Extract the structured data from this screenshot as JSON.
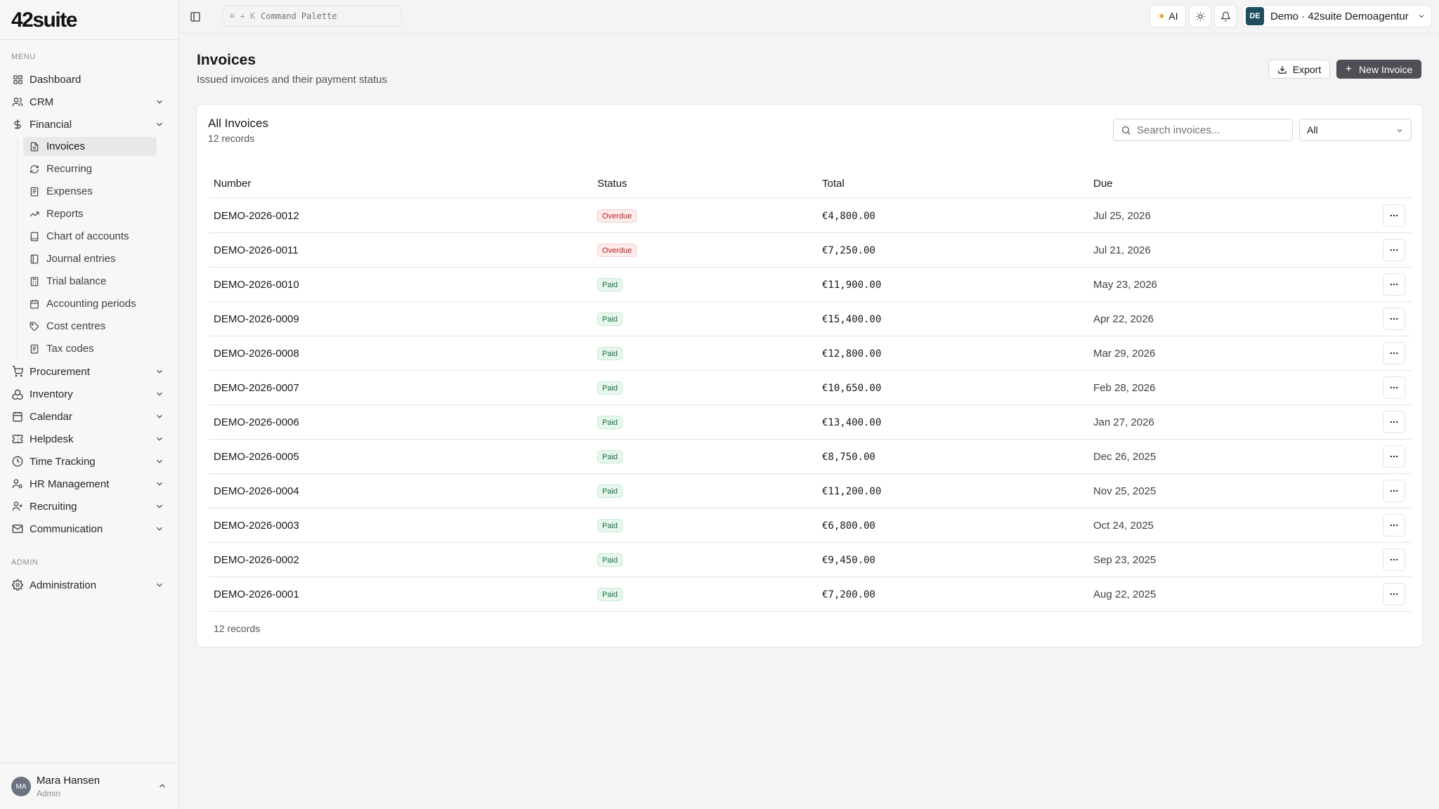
{
  "app": {
    "logo": "42suite"
  },
  "sidebar": {
    "menu_label": "MENU",
    "admin_label": "ADMIN",
    "items": [
      {
        "label": "Dashboard",
        "icon": "grid-icon"
      },
      {
        "label": "CRM",
        "icon": "users-icon"
      },
      {
        "label": "Financial",
        "icon": "dollar-icon"
      }
    ],
    "financial_sub": [
      {
        "label": "Invoices",
        "icon": "file-icon"
      },
      {
        "label": "Recurring",
        "icon": "refresh-icon"
      },
      {
        "label": "Expenses",
        "icon": "receipt-icon"
      },
      {
        "label": "Reports",
        "icon": "trending-icon"
      },
      {
        "label": "Chart of accounts",
        "icon": "book-icon"
      },
      {
        "label": "Journal entries",
        "icon": "book-open-icon"
      },
      {
        "label": "Trial balance",
        "icon": "calculator-icon"
      },
      {
        "label": "Accounting periods",
        "icon": "calendar-icon"
      },
      {
        "label": "Cost centres",
        "icon": "tag-icon"
      },
      {
        "label": "Tax codes",
        "icon": "receipt-icon"
      }
    ],
    "more_items": [
      {
        "label": "Procurement",
        "icon": "cart-icon"
      },
      {
        "label": "Inventory",
        "icon": "boxes-icon"
      },
      {
        "label": "Calendar",
        "icon": "calendar-icon"
      },
      {
        "label": "Helpdesk",
        "icon": "ticket-icon"
      },
      {
        "label": "Time Tracking",
        "icon": "clock-icon"
      },
      {
        "label": "HR Management",
        "icon": "user-cog-icon"
      },
      {
        "label": "Recruiting",
        "icon": "user-plus-icon"
      },
      {
        "label": "Communication",
        "icon": "mail-icon"
      }
    ],
    "admin_items": [
      {
        "label": "Administration",
        "icon": "gear-icon"
      }
    ],
    "user": {
      "initials": "MA",
      "name": "Mara Hansen",
      "role": "Admin"
    }
  },
  "topbar": {
    "command_kbd": "⌘ + K",
    "command_label": "Command Palette",
    "ai_label": "AI",
    "org_initials": "DE",
    "org_label": "Demo · 42suite Demoagentur"
  },
  "page": {
    "title": "Invoices",
    "subtitle": "Issued invoices and their payment status",
    "export_label": "Export",
    "new_label": "New Invoice"
  },
  "card": {
    "title": "All Invoices",
    "count": "12 records",
    "search_placeholder": "Search invoices...",
    "filter_value": "All",
    "footer_count": "12 records",
    "columns": [
      "Number",
      "Status",
      "Total",
      "Due"
    ]
  },
  "invoices": [
    {
      "number": "DEMO-2026-0012",
      "status": "Overdue",
      "total": "€4,800.00",
      "due": "Jul 25, 2026"
    },
    {
      "number": "DEMO-2026-0011",
      "status": "Overdue",
      "total": "€7,250.00",
      "due": "Jul 21, 2026"
    },
    {
      "number": "DEMO-2026-0010",
      "status": "Paid",
      "total": "€11,900.00",
      "due": "May 23, 2026"
    },
    {
      "number": "DEMO-2026-0009",
      "status": "Paid",
      "total": "€15,400.00",
      "due": "Apr 22, 2026"
    },
    {
      "number": "DEMO-2026-0008",
      "status": "Paid",
      "total": "€12,800.00",
      "due": "Mar 29, 2026"
    },
    {
      "number": "DEMO-2026-0007",
      "status": "Paid",
      "total": "€10,650.00",
      "due": "Feb 28, 2026"
    },
    {
      "number": "DEMO-2026-0006",
      "status": "Paid",
      "total": "€13,400.00",
      "due": "Jan 27, 2026"
    },
    {
      "number": "DEMO-2026-0005",
      "status": "Paid",
      "total": "€8,750.00",
      "due": "Dec 26, 2025"
    },
    {
      "number": "DEMO-2026-0004",
      "status": "Paid",
      "total": "€11,200.00",
      "due": "Nov 25, 2025"
    },
    {
      "number": "DEMO-2026-0003",
      "status": "Paid",
      "total": "€6,800.00",
      "due": "Oct 24, 2025"
    },
    {
      "number": "DEMO-2026-0002",
      "status": "Paid",
      "total": "€9,450.00",
      "due": "Sep 23, 2025"
    },
    {
      "number": "DEMO-2026-0001",
      "status": "Paid",
      "total": "€7,200.00",
      "due": "Aug 22, 2025"
    }
  ],
  "colors": {
    "overdue": "#b91c1c",
    "paid": "#17703a",
    "primary_button": "#4f4f55",
    "org_avatar": "#1f4e5f"
  }
}
